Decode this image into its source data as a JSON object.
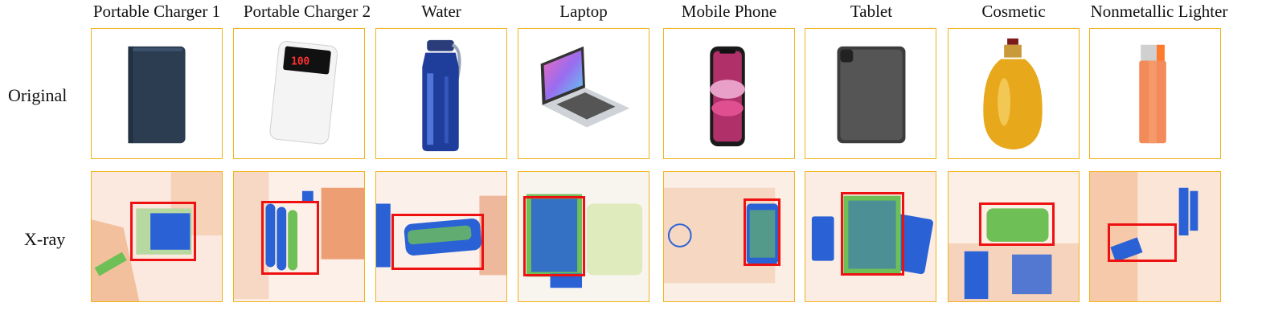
{
  "columns": [
    {
      "title": "Portable Charger 1"
    },
    {
      "title": "Portable Charger 2"
    },
    {
      "title": "Water"
    },
    {
      "title": "Laptop"
    },
    {
      "title": "Mobile Phone"
    },
    {
      "title": "Tablet"
    },
    {
      "title": "Cosmetic"
    },
    {
      "title": "Nonmetallic Lighter"
    }
  ],
  "rows": {
    "original_label": "Original",
    "xray_label": "X-ray"
  },
  "power_bank_display": "100",
  "colors": {
    "cell_border": "#f2b31c",
    "bbox": "#ee1111",
    "xray_blue": "#2a62d6",
    "xray_green": "#6fbf57",
    "xray_orange": "#e88a55"
  }
}
